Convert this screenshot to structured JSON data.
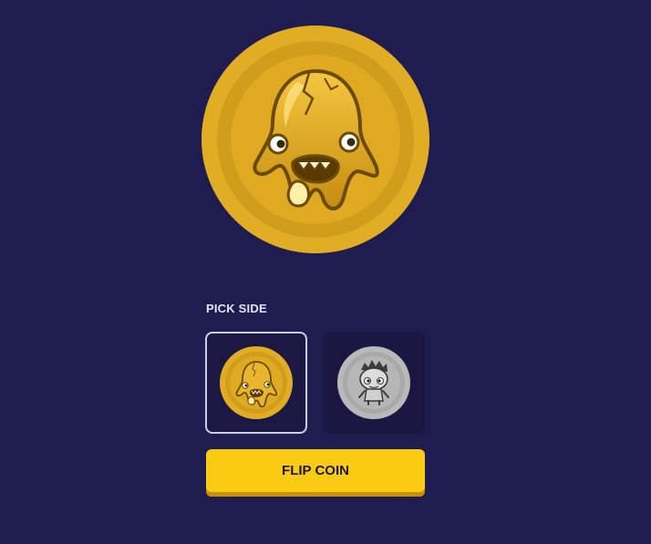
{
  "coin": {
    "current_side": "monster-face",
    "gold_color": "#e0ac22",
    "silver_color": "#b8b8b8"
  },
  "picker": {
    "label": "PICK SIDE",
    "options": [
      {
        "side": "monster",
        "icon": "gold-monster-coin-icon",
        "selected": true
      },
      {
        "side": "zombie",
        "icon": "silver-zombie-coin-icon",
        "selected": false
      }
    ]
  },
  "actions": {
    "flip_label": "FLIP COIN",
    "flip_color": "#fbcb14"
  },
  "theme": {
    "background": "#1f1c4f"
  }
}
